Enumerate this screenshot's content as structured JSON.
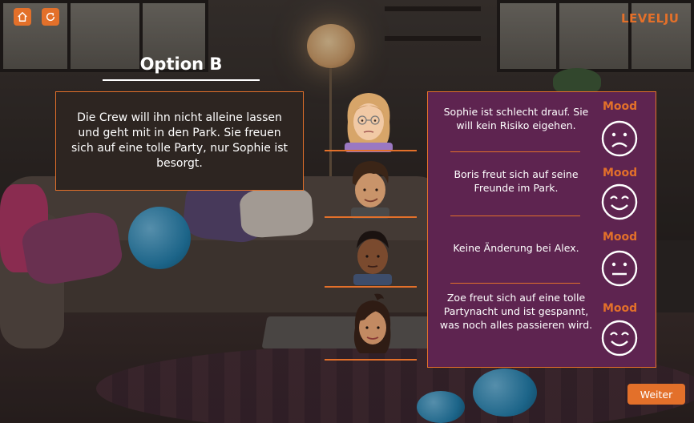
{
  "header": {
    "home_icon": "home-icon",
    "refresh_icon": "refresh-icon",
    "logo": "LEVELJU"
  },
  "title": "Option B",
  "story": {
    "text": "Die Crew will ihn nicht alleine lassen und geht mit in den Park. Sie freuen sich auf eine tolle Party, nur Sophie ist besorgt."
  },
  "characters": [
    {
      "name": "Sophie",
      "text": "Sophie ist schlecht drauf. Sie will kein Risiko eigehen.",
      "mood_label": "Mood",
      "mood": "sad"
    },
    {
      "name": "Boris",
      "text": "Boris freut sich auf seine Freunde im Park.",
      "mood_label": "Mood",
      "mood": "happy"
    },
    {
      "name": "Alex",
      "text": "Keine Änderung bei Alex.",
      "mood_label": "Mood",
      "mood": "neutral"
    },
    {
      "name": "Zoe",
      "text": "Zoe freut sich auf eine tolle Partynacht und ist gespannt, was noch alles passieren wird.",
      "mood_label": "Mood",
      "mood": "happy"
    }
  ],
  "next_button": "Weiter",
  "colors": {
    "accent": "#e3702a",
    "mood_panel": "#5e2450",
    "story_bg": "#2d2521"
  }
}
